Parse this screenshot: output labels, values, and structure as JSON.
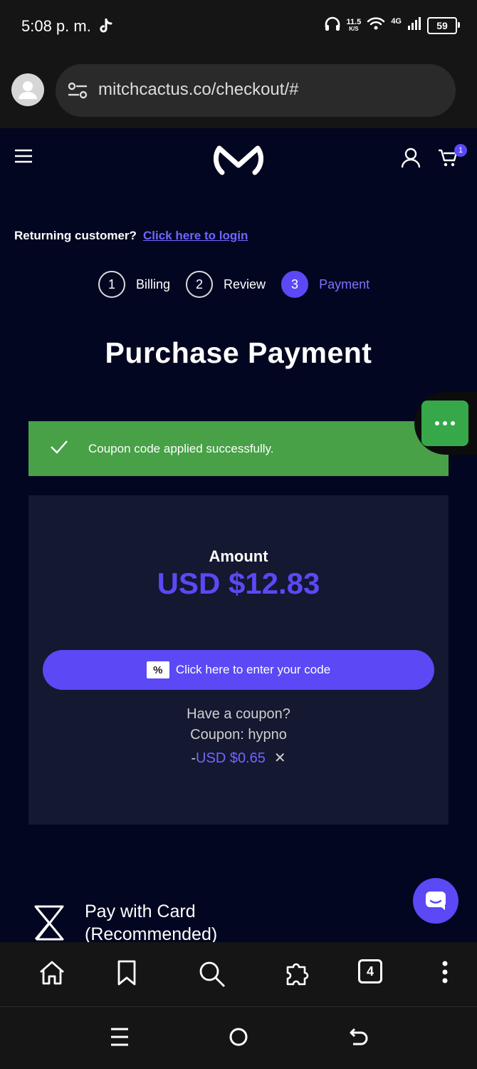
{
  "status_bar": {
    "time": "5:08 p. m.",
    "speed_value": "11.5",
    "speed_unit": "K/S",
    "network": "4G",
    "battery": "59",
    "icons": [
      "tiktok-icon",
      "headphones-icon",
      "wifi-icon",
      "signal-icon",
      "battery-icon"
    ]
  },
  "browser": {
    "url": "mitchcactus.co/checkout/#",
    "tab_count": "4",
    "toolbar_icons": [
      "home-icon",
      "bookmark-icon",
      "search-icon",
      "extensions-icon",
      "tabs-icon",
      "more-icon"
    ]
  },
  "header": {
    "icons": [
      "menu-icon",
      "logo",
      "user-icon",
      "cart-icon"
    ],
    "cart_count": "1"
  },
  "checkout": {
    "returning_text": "Returning customer?",
    "login_link": "Click here to login",
    "steps": [
      {
        "number": "1",
        "label": "Billing",
        "active": false
      },
      {
        "number": "2",
        "label": "Review",
        "active": false
      },
      {
        "number": "3",
        "label": "Payment",
        "active": true
      }
    ],
    "title": "Purchase Payment",
    "success_message": "Coupon code applied successfully.",
    "amount_label": "Amount",
    "amount_value": "USD $12.83",
    "code_button_label": "Click here to enter your code",
    "code_button_icon": "%",
    "have_coupon": "Have a coupon?",
    "coupon_line": "Coupon: hypno",
    "discount_prefix": "-",
    "discount_value": "USD $0.65",
    "remove_symbol": "✕",
    "pay_card_line1": "Pay with Card",
    "pay_card_line2": "(Recommended)"
  },
  "colors": {
    "accent": "#5a49f5",
    "success": "#48a047",
    "page_bg": "#020620",
    "card_bg": "#141830"
  }
}
